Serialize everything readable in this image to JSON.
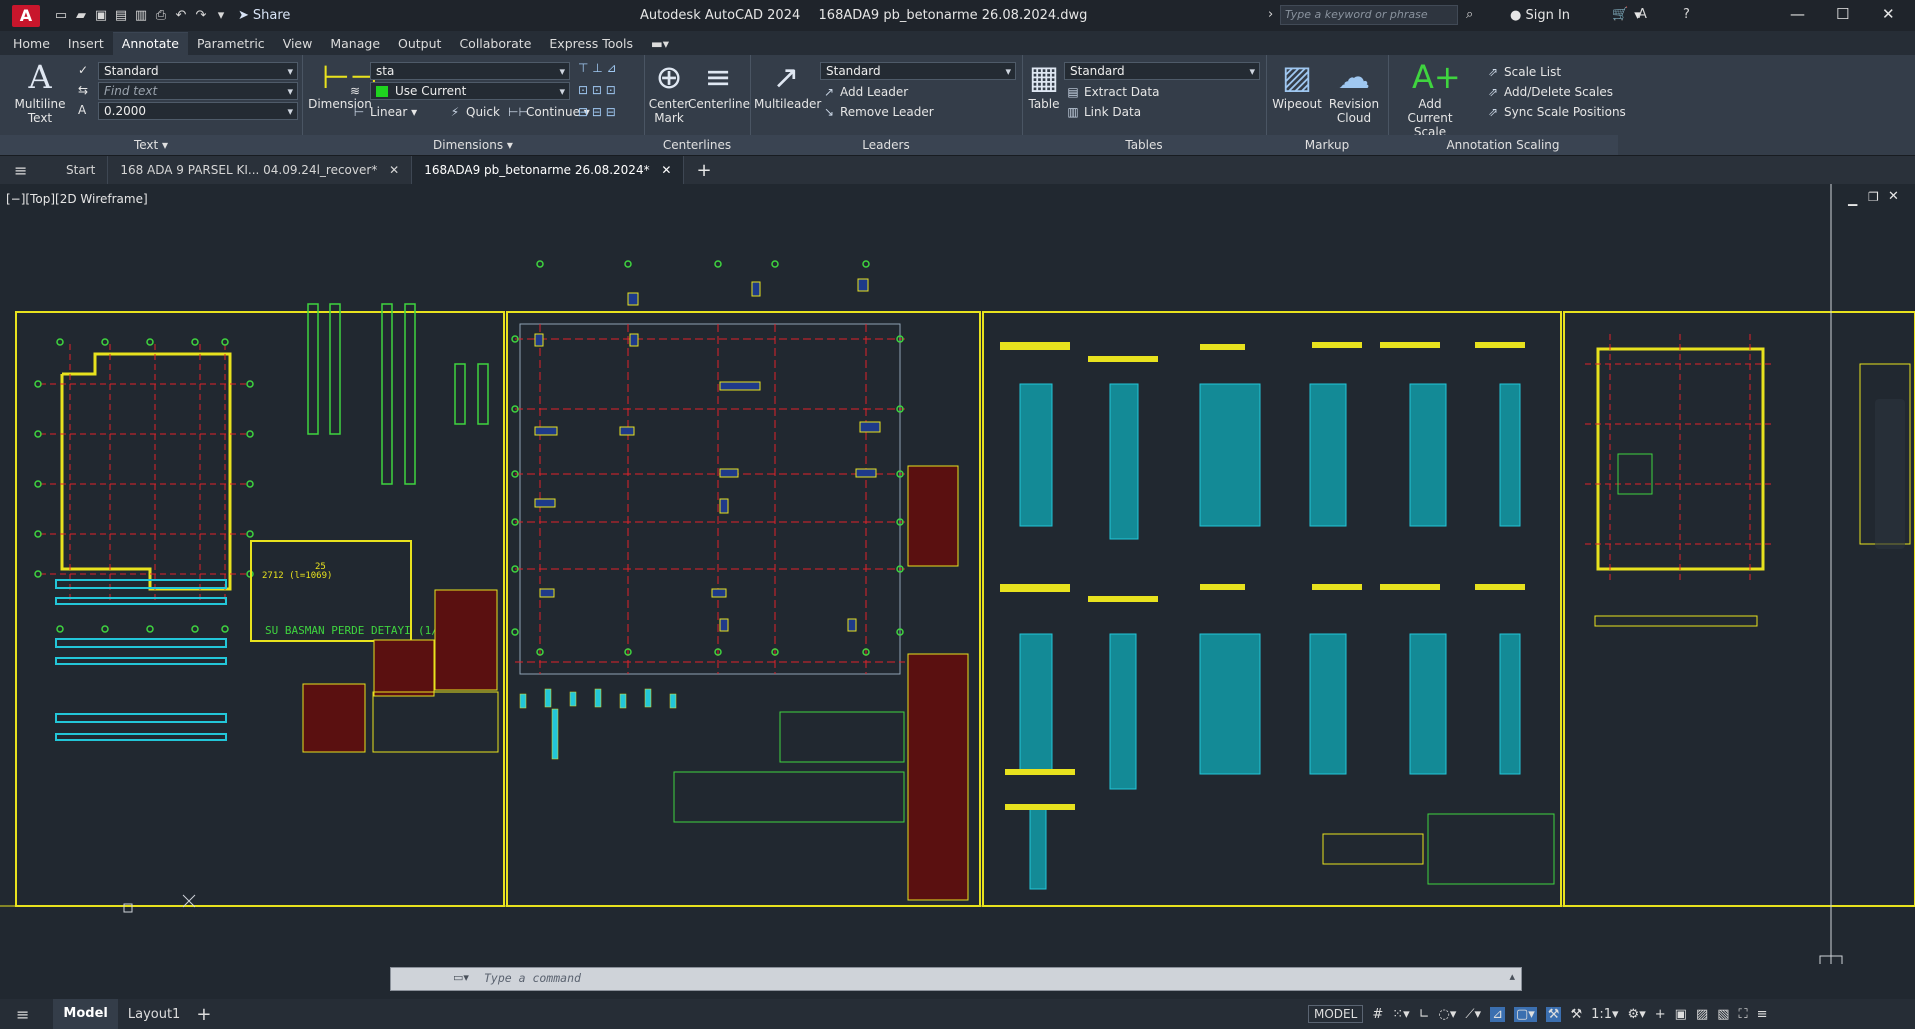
{
  "titlebar": {
    "app_name": "Autodesk AutoCAD 2024",
    "file_name": "168ADA9 pb_betonarme 26.08.2024.dwg",
    "share_label": "Share",
    "search_placeholder": "Type a keyword or phrase",
    "sign_in_label": "Sign In"
  },
  "menu": {
    "items": [
      "Home",
      "Insert",
      "Annotate",
      "Parametric",
      "View",
      "Manage",
      "Output",
      "Collaborate",
      "Express Tools"
    ],
    "active": "Annotate"
  },
  "ribbon": {
    "text_panel": {
      "title": "Text",
      "multiline_label_1": "Multiline",
      "multiline_label_2": "Text",
      "style_value": "Standard",
      "find_placeholder": "Find text",
      "height_value": "0.2000"
    },
    "dimensions_panel": {
      "title": "Dimensions",
      "dimension_label": "Dimension",
      "style_value": "sta",
      "layer_value": "Use Current",
      "linear_label": "Linear",
      "quick_label": "Quick",
      "continue_label": "Continue"
    },
    "centerlines_panel": {
      "title": "Centerlines",
      "center_mark_1": "Center",
      "center_mark_2": "Mark",
      "centerline_label": "Centerline"
    },
    "leaders_panel": {
      "title": "Leaders",
      "multileader_label": "Multileader",
      "style_value": "Standard",
      "add_leader": "Add Leader",
      "remove_leader": "Remove Leader"
    },
    "tables_panel": {
      "title": "Tables",
      "table_label": "Table",
      "style_value": "Standard",
      "extract_data": "Extract Data",
      "link_data": "Link Data"
    },
    "markup_panel": {
      "title": "Markup",
      "wipeout_label": "Wipeout",
      "revision_1": "Revision",
      "revision_2": "Cloud"
    },
    "scaling_panel": {
      "title": "Annotation Scaling",
      "add_scale_1": "Add",
      "add_scale_2": "Current Scale",
      "scale_list": "Scale List",
      "add_delete_scales": "Add/Delete Scales",
      "sync_scale": "Sync Scale Positions"
    }
  },
  "file_tabs": {
    "start": "Start",
    "tab1": "168 ADA 9 PARSEL KI... 04.09.24l_recover*",
    "tab2": "168ADA9 pb_betonarme 26.08.2024*"
  },
  "viewport": {
    "label": "[−][Top][2D Wireframe]",
    "drawing_text_detail": "SU BASMAN PERDE DETAYI",
    "drawing_text_detail_scale": "(1/",
    "drawing_text_dim": "2712 (l=1069)",
    "drawing_text_dim2": "25"
  },
  "command": {
    "placeholder": "Type a command"
  },
  "status": {
    "model_tab": "Model",
    "layout_tab": "Layout1",
    "model_label": "MODEL",
    "scale_label": "1:1"
  },
  "colors": {
    "canvas": "#212830",
    "drawing_frame": "#e8e21e",
    "grid_axis": "#e0222a",
    "rebar": "#23c6d8",
    "text_green": "#3fd43f"
  }
}
